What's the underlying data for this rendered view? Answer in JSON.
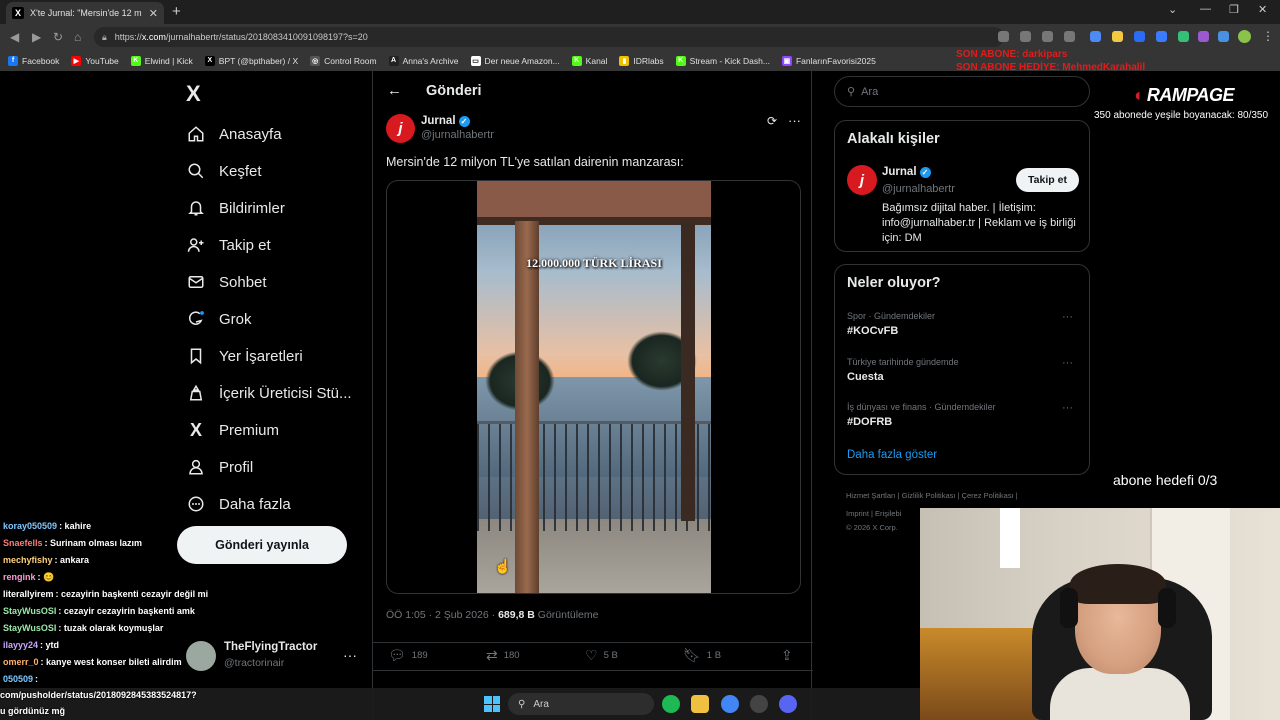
{
  "browser": {
    "tab_title": "X'te Jurnal: \"Mersin'de 12 m",
    "url_prefix": "https://",
    "url_host": "x.com",
    "url_path": "/jurnalhabertr/status/2018083410091098197?s=20",
    "bookmarks": [
      {
        "label": "Facebook",
        "color": "#1877f2",
        "glyph": "f"
      },
      {
        "label": "YouTube",
        "color": "#ff0000",
        "glyph": "▶"
      },
      {
        "label": "Elwind | Kick",
        "color": "#53fc18",
        "glyph": "K"
      },
      {
        "label": "BPT (@bpthaber) / X",
        "color": "#000000",
        "glyph": "X"
      },
      {
        "label": "Control Room",
        "color": "#555555",
        "glyph": "◎"
      },
      {
        "label": "Anna's Archive",
        "color": "#222222",
        "glyph": "A"
      },
      {
        "label": "Der neue Amazon...",
        "color": "#ffffff",
        "glyph": "▭"
      },
      {
        "label": "Kanal",
        "color": "#53fc18",
        "glyph": "K"
      },
      {
        "label": "IDRlabs",
        "color": "#f0c000",
        "glyph": "▮"
      },
      {
        "label": "Stream - Kick Dash...",
        "color": "#53fc18",
        "glyph": "K"
      },
      {
        "label": "FanlarınFavorisi2025",
        "color": "#9146ff",
        "glyph": "▣"
      }
    ]
  },
  "stream_overlay": {
    "last_sub": "SON ABONE: darkipars",
    "last_gift": "SON ABONE HEDİYE: MehmedKarahalil",
    "brand": "RAMPAGE",
    "sub_goal_1": "350 abonede yeşile boyanacak: 80/350",
    "sub_goal_2": "abone hedefi 0/3"
  },
  "x_nav": {
    "logo": "X",
    "items": [
      {
        "label": "Anasayfa",
        "icon": "home-icon"
      },
      {
        "label": "Keşfet",
        "icon": "search-icon"
      },
      {
        "label": "Bildirimler",
        "icon": "bell-icon"
      },
      {
        "label": "Takip et",
        "icon": "follow-icon"
      },
      {
        "label": "Sohbet",
        "icon": "mail-icon"
      },
      {
        "label": "Grok",
        "icon": "grok-icon"
      },
      {
        "label": "Yer İşaretleri",
        "icon": "bookmark-icon"
      },
      {
        "label": "İçerik Üreticisi Stü...",
        "icon": "creator-icon"
      },
      {
        "label": "Premium",
        "icon": "x-premium-icon"
      },
      {
        "label": "Profil",
        "icon": "profile-icon"
      },
      {
        "label": "Daha fazla",
        "icon": "more-circle-icon"
      }
    ],
    "post_button": "Gönderi yayınla",
    "account_name": "TheFlyingTractor",
    "account_handle": "@tractorinair"
  },
  "chat": [
    {
      "user": "koray050509",
      "text": ": kahire",
      "color": "#7ec8ff"
    },
    {
      "user": "Snaefells",
      "text": ": Surinam olması lazım",
      "color": "#ff7a7a"
    },
    {
      "user": "mechyfishy",
      "text": ": ankara",
      "color": "#ffd27a"
    },
    {
      "user": "rengink",
      "text": ": 😊",
      "color": "#ff9ad8"
    },
    {
      "user": "literallyirem",
      "text": ": cezayirin başkenti cezayir değil mi",
      "color": "#ffffff"
    },
    {
      "user": "StayWusOSI",
      "text": ": cezayir cezayirin başkenti amk",
      "color": "#9be7a8"
    },
    {
      "user": "StayWusOSI",
      "text": ": tuzak olarak koymuşlar",
      "color": "#9be7a8"
    },
    {
      "user": "ilayyy24",
      "text": ": ytd",
      "color": "#c9a6ff"
    },
    {
      "user": "omerr_0",
      "text": ": kanye west konser bileti alirdim",
      "color": "#ffb36b"
    },
    {
      "user": "050509",
      "text": ":",
      "color": "#7ec8ff"
    }
  ],
  "post": {
    "header": "Gönderi",
    "author_name": "Jurnal",
    "author_handle": "@jurnalhabertr",
    "text": "Mersin'de 12 milyon TL'ye satılan dairenin manzarası:",
    "video_caption": "12.000.000 TÜRK LİRASI",
    "time": "ÖÖ 1:05 · 2 Şub 2026 · ",
    "views_count": "689,8 B",
    "views_label": " Görüntüleme",
    "replies": "189",
    "reposts": "180",
    "likes": "5 B",
    "bookmarks": "1 B"
  },
  "right": {
    "search_placeholder": "Ara",
    "relevant_title": "Alakalı kişiler",
    "relevant_name": "Jurnal",
    "relevant_handle": "@jurnalhabertr",
    "follow_label": "Takip et",
    "relevant_bio": "Bağımsız dijital haber. | İletişim: info@jurnalhaber.tr | Reklam ve iş birliği için: DM",
    "trends_title": "Neler oluyor?",
    "trends": [
      {
        "context": "Spor · Gündemdekiler",
        "name": "#KOCvFB"
      },
      {
        "context": "Türkiye tarihinde gündemde",
        "name": "Cuesta"
      },
      {
        "context": "İş dünyası ve finans · Gündemdekiler",
        "name": "#DOFRB"
      }
    ],
    "show_more": "Daha fazla göster",
    "footer_line1": "Hizmet Şartları  |  Gizlilik Politikası  |  Çerez Politikası  |",
    "footer_line2": "Imprint  |  Erişilebi",
    "footer_line3": "© 2026 X Corp."
  },
  "taskbar": {
    "status_url": "com/pusholder/status/2018092845383524817?",
    "status_msg": "u gördünüz mğ",
    "search": "Ara"
  }
}
